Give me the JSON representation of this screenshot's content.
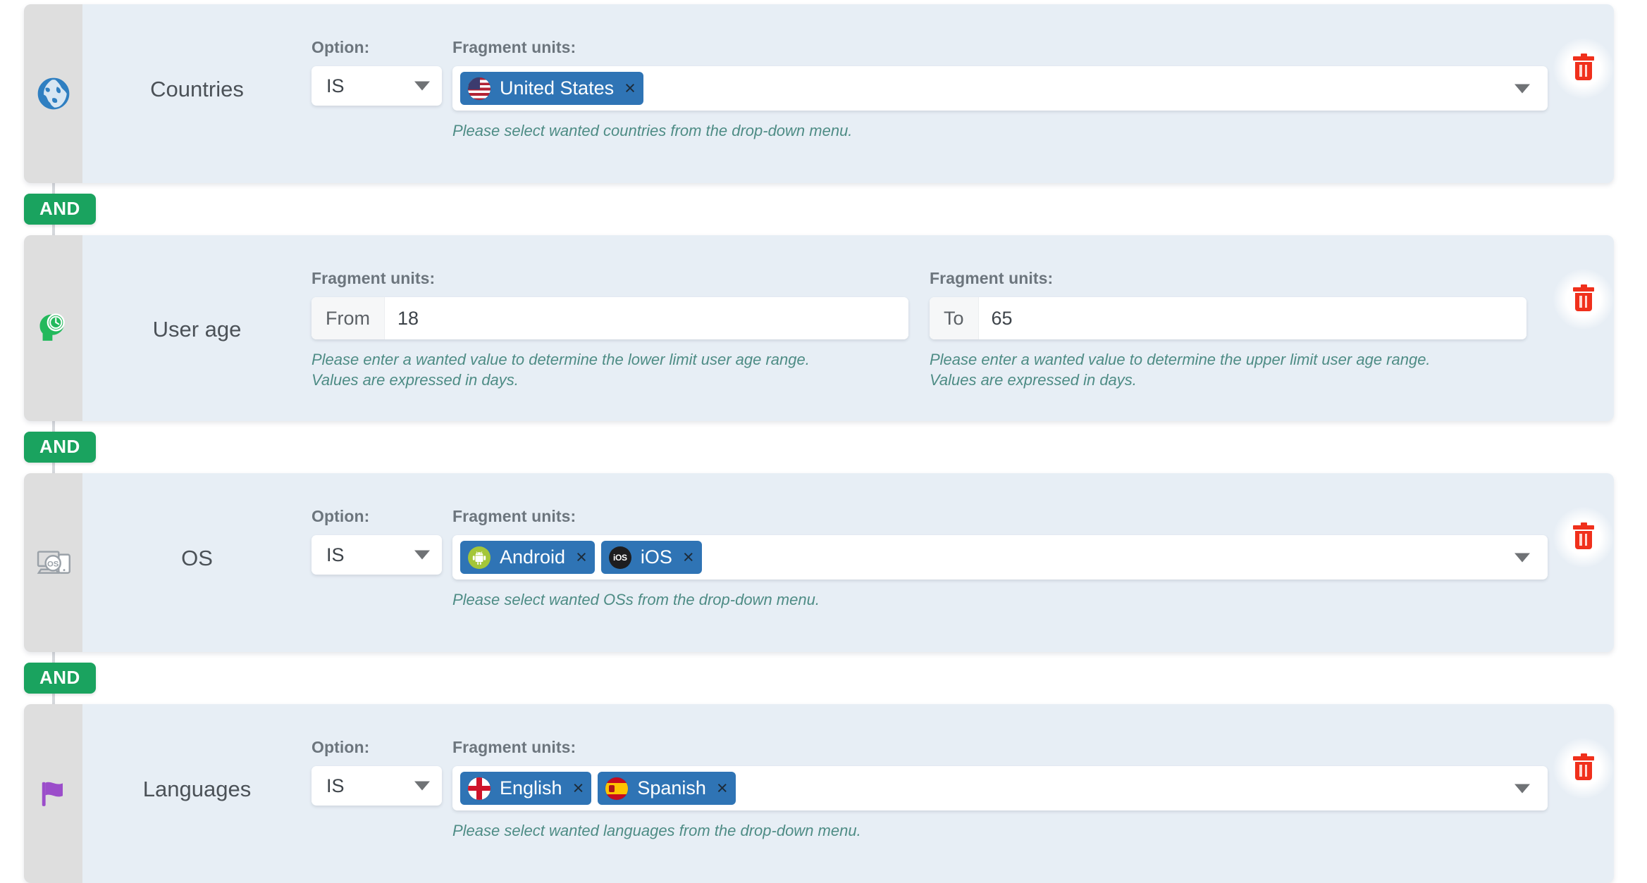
{
  "rows": [
    {
      "id": "countries",
      "icon": "globe-icon",
      "title": "Countries",
      "option_label": "Option:",
      "option_value": "IS",
      "fragment_label": "Fragment units:",
      "hint": "Please select wanted countries from the drop-down menu.",
      "chips": [
        {
          "label": "United States",
          "icon": "flag-us-icon",
          "remove": "×"
        }
      ]
    },
    {
      "id": "user-age",
      "icon": "user-age-icon",
      "title": "User age",
      "from": {
        "fragment_label": "Fragment units:",
        "addon": "From",
        "value": "18",
        "hint_line1": "Please enter a wanted value to determine the lower limit user age range.",
        "hint_line2": "Values are expressed in days."
      },
      "to": {
        "fragment_label": "Fragment units:",
        "addon": "To",
        "value": "65",
        "hint_line1": "Please enter a wanted value to determine the upper limit user age range.",
        "hint_line2": "Values are expressed in days."
      }
    },
    {
      "id": "os",
      "icon": "os-icon",
      "title": "OS",
      "option_label": "Option:",
      "option_value": "IS",
      "fragment_label": "Fragment units:",
      "hint": "Please select wanted OSs from the drop-down menu.",
      "chips": [
        {
          "label": "Android",
          "icon": "android-icon",
          "remove": "×"
        },
        {
          "label": "iOS",
          "icon": "ios-icon",
          "remove": "×",
          "badge_text": "iOS"
        }
      ]
    },
    {
      "id": "languages",
      "icon": "flag-icon",
      "title": "Languages",
      "option_label": "Option:",
      "option_value": "IS",
      "fragment_label": "Fragment units:",
      "hint": "Please select wanted languages from the drop-down menu.",
      "chips": [
        {
          "label": "English",
          "icon": "flag-england-icon",
          "remove": "×"
        },
        {
          "label": "Spanish",
          "icon": "flag-spain-icon",
          "remove": "×"
        }
      ]
    }
  ],
  "connectors": [
    {
      "label": "AND"
    },
    {
      "label": "AND"
    },
    {
      "label": "AND"
    }
  ],
  "colors": {
    "card_bg": "#e7eef5",
    "gutter_bg": "#dedede",
    "chip_bg": "#2f74b5",
    "and_bg": "#1aa35f",
    "hint_text": "#4e8c85",
    "delete_red": "#f0301c"
  }
}
